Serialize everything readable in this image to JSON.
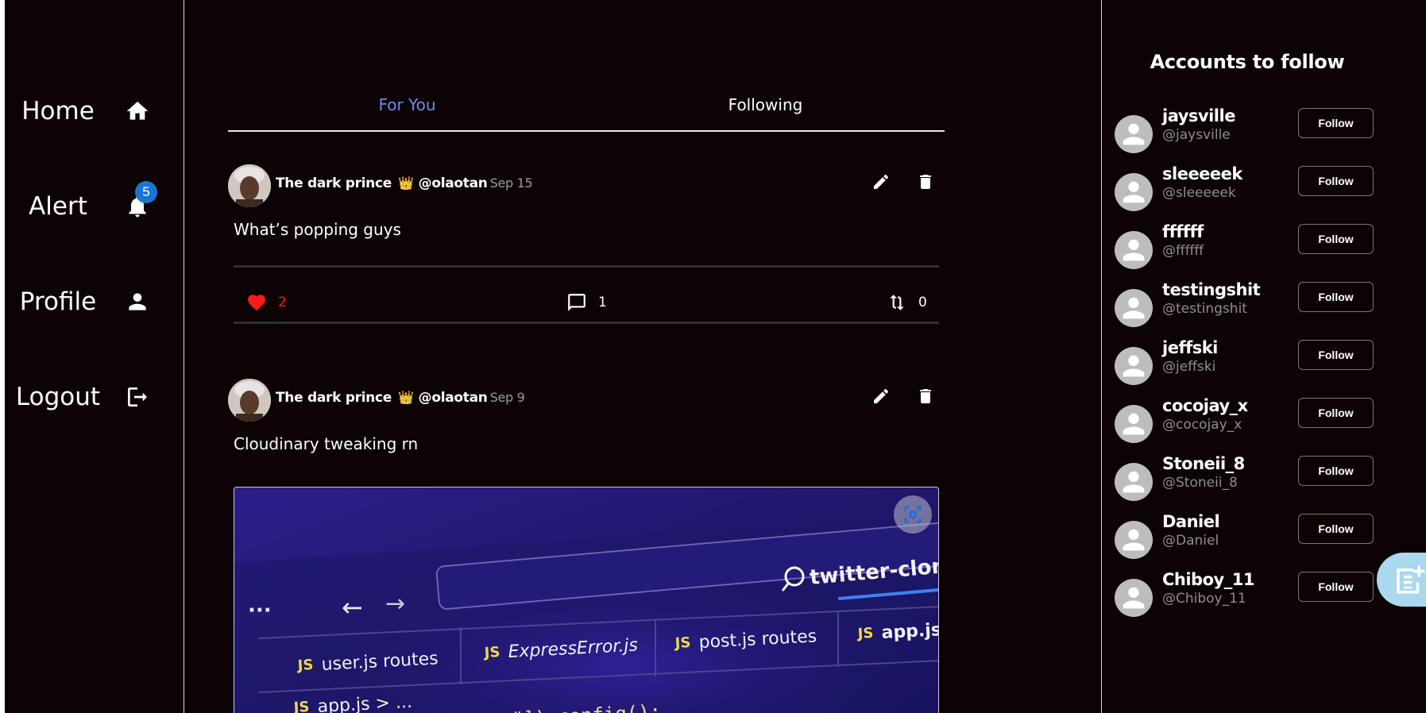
{
  "sidebar": {
    "items": [
      {
        "label": "Home",
        "icon": "home-icon"
      },
      {
        "label": "Alert",
        "icon": "bell-icon",
        "badge": "5"
      },
      {
        "label": "Profile",
        "icon": "person-icon"
      },
      {
        "label": "Logout",
        "icon": "logout-icon"
      }
    ]
  },
  "main": {
    "tabs": [
      {
        "label": "For You",
        "active": true
      },
      {
        "label": "Following",
        "active": false
      }
    ],
    "posts": [
      {
        "author": "The dark prince",
        "crown": "👑",
        "handle": "@olaotan",
        "date": "Sep 15",
        "text": "What’s popping guys",
        "likes": "2",
        "comments": "1",
        "reposts": "0"
      },
      {
        "author": "The dark prince",
        "crown": "👑",
        "handle": "@olaotan",
        "date": "Sep 9",
        "text": "Cloudinary tweaking rn",
        "image": {
          "search_text": "twitter-clone-b",
          "tabs": [
            "user.js routes",
            "ExpressError.js",
            "post.js routes",
            "app.js"
          ],
          "breadcrumb": "app.js > ...",
          "code": "\"]).config();"
        }
      }
    ]
  },
  "right": {
    "title": "Accounts to follow",
    "follow_label": "Follow",
    "accounts": [
      {
        "name": "jaysville",
        "handle": "@jaysville"
      },
      {
        "name": "sleeeeek",
        "handle": "@sleeeeek"
      },
      {
        "name": "ffffff",
        "handle": "@ffffff"
      },
      {
        "name": "testingshit",
        "handle": "@testingshit"
      },
      {
        "name": "jeffski",
        "handle": "@jeffski"
      },
      {
        "name": "cocojay_x",
        "handle": "@cocojay_x"
      },
      {
        "name": "Stoneii_8",
        "handle": "@Stoneii_8"
      },
      {
        "name": "Daniel",
        "handle": "@Daniel"
      },
      {
        "name": "Chiboy_11",
        "handle": "@Chiboy_11"
      }
    ]
  },
  "colors": {
    "background": "#0d0204",
    "accent_tab": "#6b8cf0",
    "like": "#ff1a1a",
    "badge": "#1976d2",
    "fab": "#a9d8ef"
  }
}
